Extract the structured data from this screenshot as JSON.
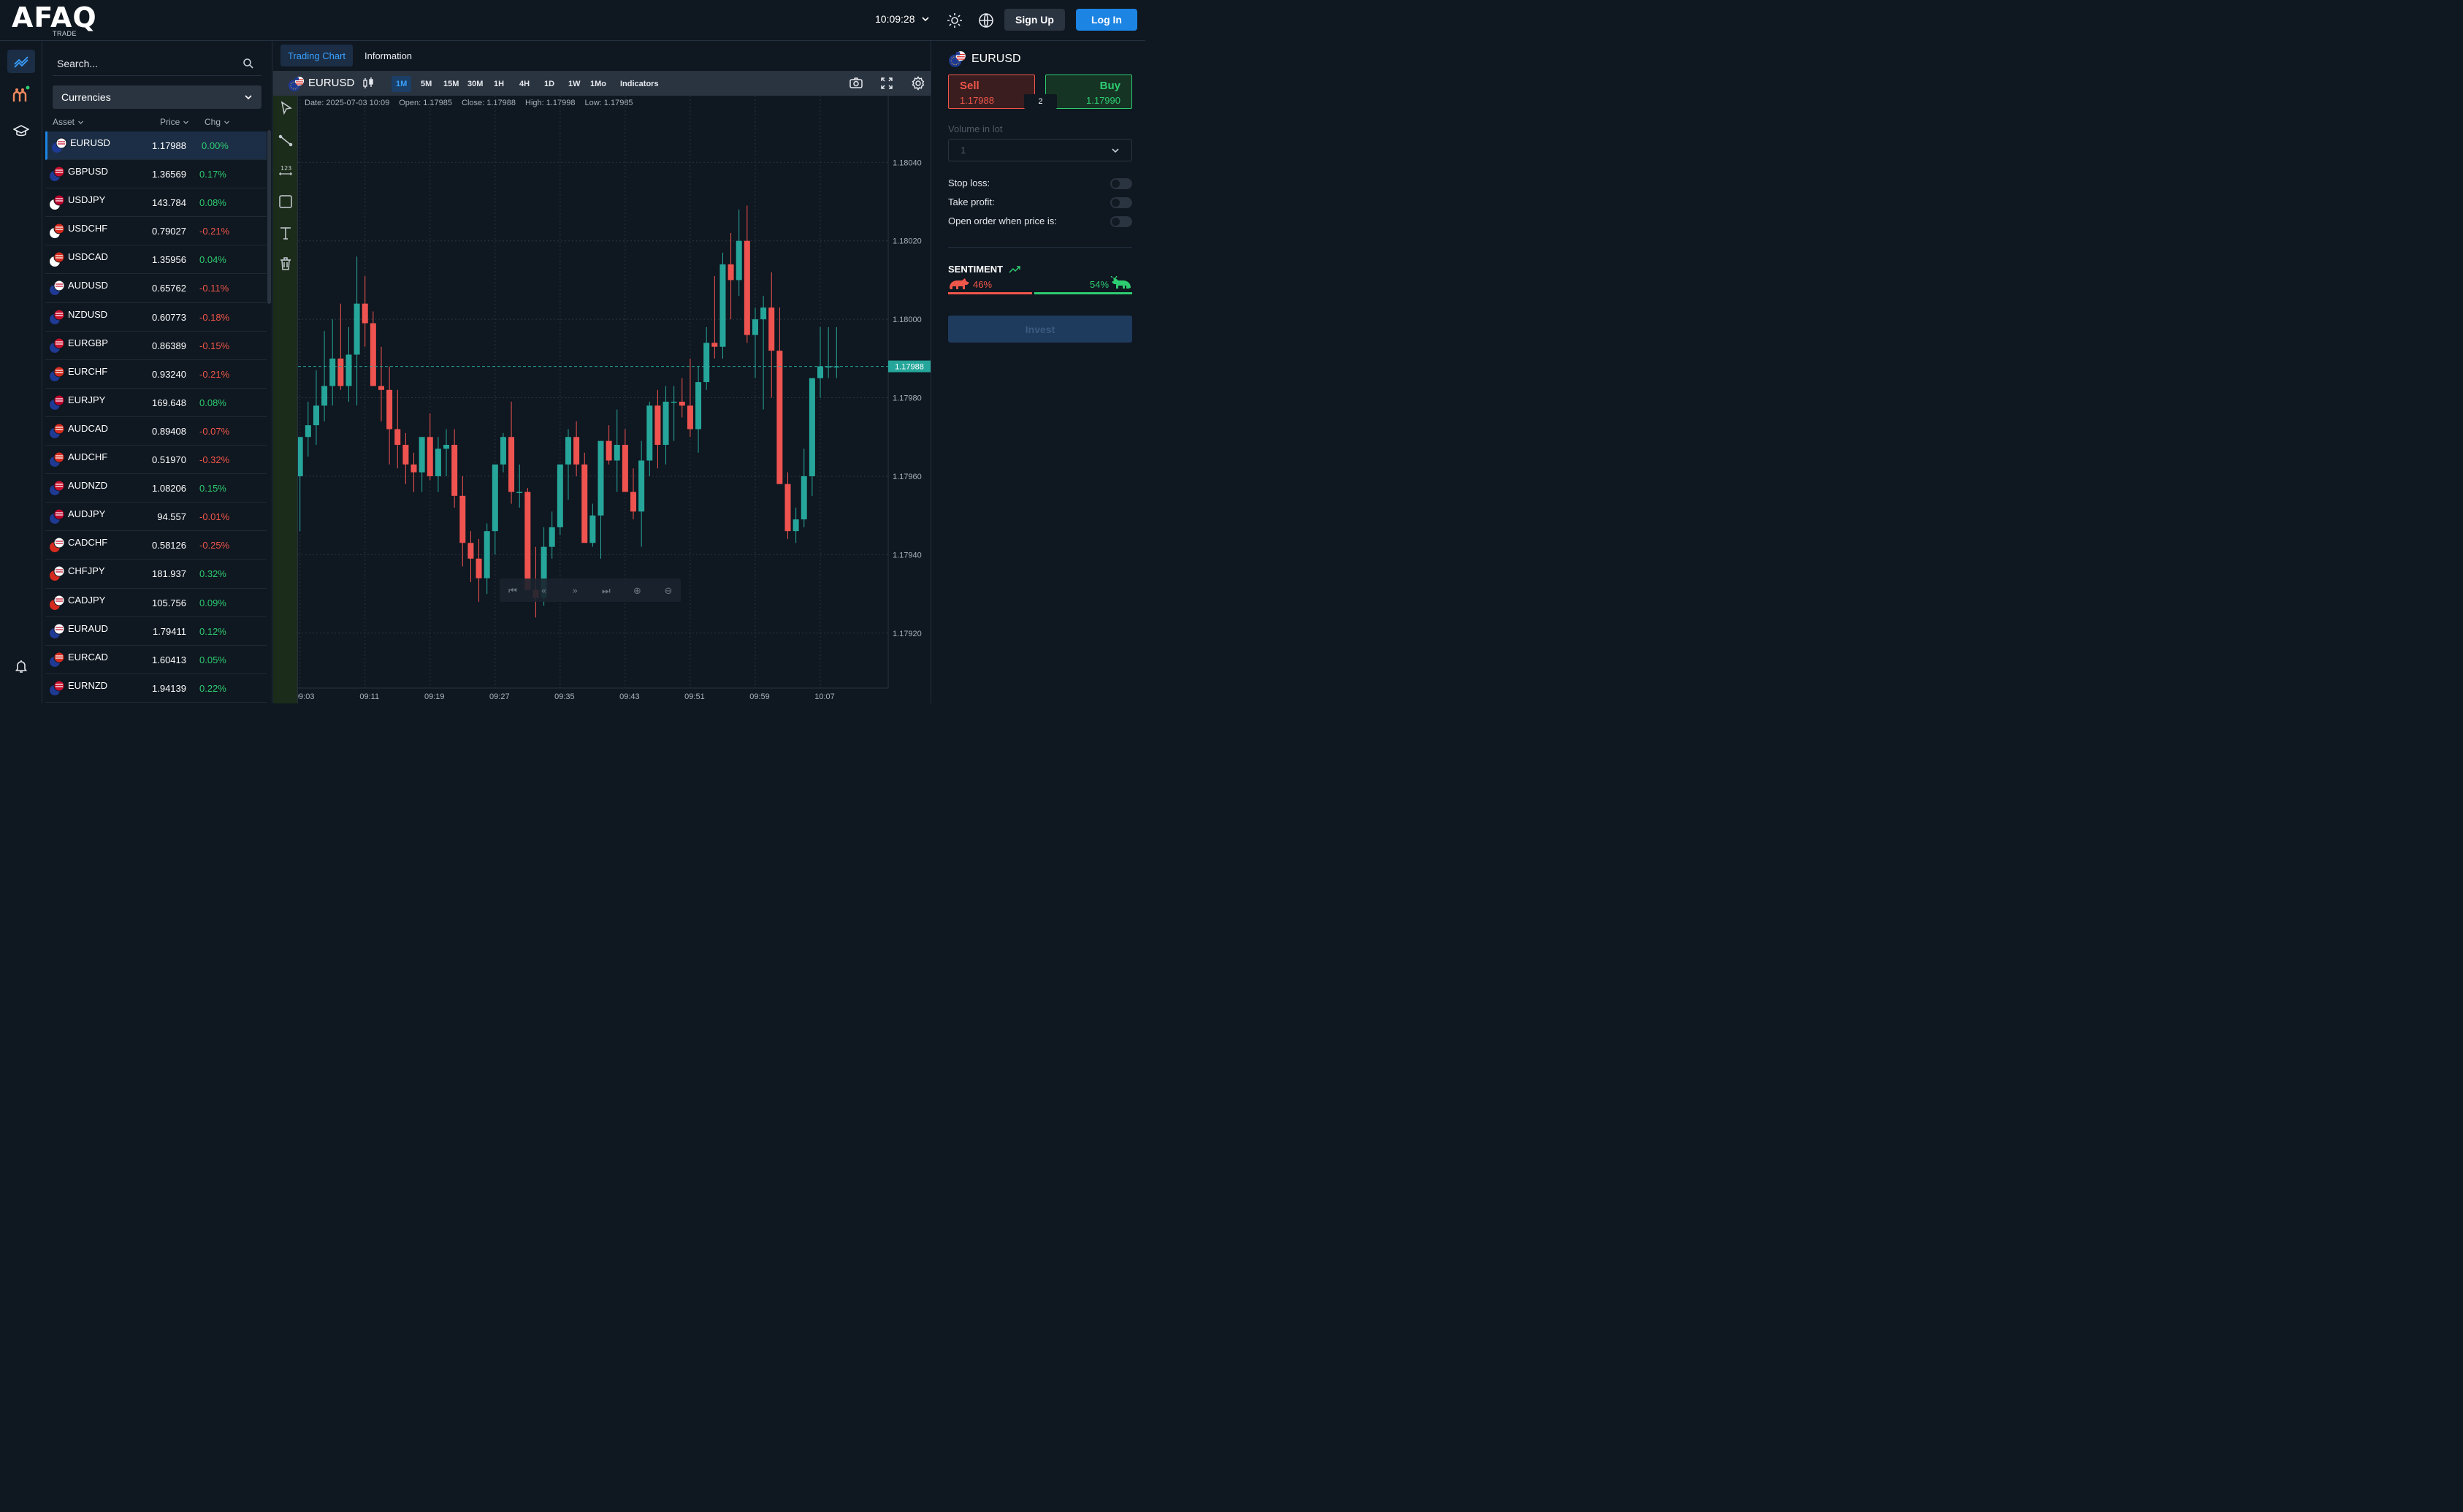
{
  "brand": {
    "name": "AFAQ",
    "sub": "TRADE"
  },
  "header": {
    "time": "10:09:28",
    "signup": "Sign Up",
    "login": "Log In"
  },
  "watchlist": {
    "search_placeholder": "Search...",
    "category": "Currencies",
    "cols": {
      "asset": "Asset",
      "price": "Price",
      "chg": "Chg"
    },
    "rows": [
      {
        "symbol": "EURUSD",
        "price": "1.17988",
        "chg": "0.00%"
      },
      {
        "symbol": "GBPUSD",
        "price": "1.36569",
        "chg": "0.17%"
      },
      {
        "symbol": "USDJPY",
        "price": "143.784",
        "chg": "0.08%"
      },
      {
        "symbol": "USDCHF",
        "price": "0.79027",
        "chg": "-0.21%"
      },
      {
        "symbol": "USDCAD",
        "price": "1.35956",
        "chg": "0.04%"
      },
      {
        "symbol": "AUDUSD",
        "price": "0.65762",
        "chg": "-0.11%"
      },
      {
        "symbol": "NZDUSD",
        "price": "0.60773",
        "chg": "-0.18%"
      },
      {
        "symbol": "EURGBP",
        "price": "0.86389",
        "chg": "-0.15%"
      },
      {
        "symbol": "EURCHF",
        "price": "0.93240",
        "chg": "-0.21%"
      },
      {
        "symbol": "EURJPY",
        "price": "169.648",
        "chg": "0.08%"
      },
      {
        "symbol": "AUDCAD",
        "price": "0.89408",
        "chg": "-0.07%"
      },
      {
        "symbol": "AUDCHF",
        "price": "0.51970",
        "chg": "-0.32%"
      },
      {
        "symbol": "AUDNZD",
        "price": "1.08206",
        "chg": "0.15%"
      },
      {
        "symbol": "AUDJPY",
        "price": "94.557",
        "chg": "-0.01%"
      },
      {
        "symbol": "CADCHF",
        "price": "0.58126",
        "chg": "-0.25%"
      },
      {
        "symbol": "CHFJPY",
        "price": "181.937",
        "chg": "0.32%"
      },
      {
        "symbol": "CADJPY",
        "price": "105.756",
        "chg": "0.09%"
      },
      {
        "symbol": "EURAUD",
        "price": "1.79411",
        "chg": "0.12%"
      },
      {
        "symbol": "EURCAD",
        "price": "1.60413",
        "chg": "0.05%"
      },
      {
        "symbol": "EURNZD",
        "price": "1.94139",
        "chg": "0.22%"
      }
    ]
  },
  "chart": {
    "tabs": [
      "Trading Chart",
      "Information"
    ],
    "symbol": "EURUSD",
    "timeframes": [
      "1M",
      "5M",
      "15M",
      "30M",
      "1H",
      "4H",
      "1D",
      "1W",
      "1Mo"
    ],
    "active_timeframe": "1M",
    "indicators": "Indicators",
    "ohlc": {
      "date": "Date: 2025-07-03 10:09",
      "open": "Open: 1.17985",
      "close": "Close: 1.17988",
      "high": "High: 1.17998",
      "low": "Low: 1.17985"
    },
    "y_ticks": [
      "1.18040",
      "1.18020",
      "1.18000",
      "1.17980",
      "1.17960",
      "1.17940",
      "1.17920"
    ],
    "x_ticks": [
      "09:03",
      "09:11",
      "09:19",
      "09:27",
      "09:35",
      "09:43",
      "09:51",
      "09:59",
      "10:07"
    ],
    "last_price": "1.17988",
    "colors": {
      "up": "#26a69a",
      "down": "#ef5350"
    }
  },
  "trade": {
    "symbol": "EURUSD",
    "sell_label": "Sell",
    "sell_price": "1.17988",
    "buy_label": "Buy",
    "buy_price": "1.17990",
    "spread": "2",
    "volume_label": "Volume in lot",
    "volume_value": "1",
    "stop_loss": "Stop loss:",
    "take_profit": "Take profit:",
    "open_when": "Open order when price is:",
    "sentiment": "SENTIMENT",
    "bear_pct": "46%",
    "bull_pct": "54%",
    "invest": "Invest"
  },
  "chart_data": {
    "type": "candlestick",
    "x": [
      "09:03",
      "09:04",
      "09:05",
      "09:06",
      "09:07",
      "09:08",
      "09:09",
      "09:10",
      "09:11",
      "09:12",
      "09:13",
      "09:14",
      "09:15",
      "09:16",
      "09:17",
      "09:18",
      "09:19",
      "09:20",
      "09:21",
      "09:22",
      "09:23",
      "09:24",
      "09:25",
      "09:26",
      "09:27",
      "09:28",
      "09:29",
      "09:30",
      "09:31",
      "09:32",
      "09:33",
      "09:34",
      "09:35",
      "09:36",
      "09:37",
      "09:38",
      "09:39",
      "09:40",
      "09:41",
      "09:42",
      "09:43",
      "09:44",
      "09:45",
      "09:46",
      "09:47",
      "09:48",
      "09:49",
      "09:50",
      "09:51",
      "09:52",
      "09:53",
      "09:54",
      "09:55",
      "09:56",
      "09:57",
      "09:58",
      "09:59",
      "10:00",
      "10:01",
      "10:02",
      "10:03",
      "10:04",
      "10:05",
      "10:06",
      "10:07",
      "10:08",
      "10:09"
    ],
    "open": [
      1.1796,
      1.1797,
      1.17973,
      1.17978,
      1.17983,
      1.1799,
      1.17983,
      1.17991,
      1.18004,
      1.17999,
      1.17983,
      1.17982,
      1.17972,
      1.17968,
      1.17963,
      1.17961,
      1.1797,
      1.1796,
      1.17967,
      1.17968,
      1.17955,
      1.17943,
      1.17939,
      1.17934,
      1.17946,
      1.17963,
      1.1797,
      1.17956,
      1.17956,
      1.17931,
      1.17929,
      1.17942,
      1.17947,
      1.17963,
      1.1797,
      1.17963,
      1.17943,
      1.1795,
      1.17969,
      1.17964,
      1.17968,
      1.17956,
      1.17951,
      1.17964,
      1.17978,
      1.17968,
      1.17979,
      1.17979,
      1.17978,
      1.17972,
      1.17984,
      1.17994,
      1.17993,
      1.18014,
      1.1801,
      1.1802,
      1.17996,
      1.18,
      1.18003,
      1.17992,
      1.17958,
      1.17946,
      1.17949,
      1.1796,
      1.17985,
      1.17988,
      1.17988
    ],
    "high": [
      1.17963,
      1.17979,
      1.17987,
      1.17997,
      1.18,
      1.18004,
      1.17998,
      1.18016,
      1.18011,
      1.18002,
      1.17993,
      1.17988,
      1.17982,
      1.17971,
      1.17966,
      1.1797,
      1.17976,
      1.1797,
      1.17972,
      1.17972,
      1.1796,
      1.17946,
      1.17944,
      1.17948,
      1.17962,
      1.17971,
      1.17979,
      1.17963,
      1.17957,
      1.17942,
      1.17947,
      1.17951,
      1.17963,
      1.17972,
      1.17974,
      1.17966,
      1.17953,
      1.17966,
      1.17973,
      1.17977,
      1.17972,
      1.17962,
      1.17969,
      1.17979,
      1.17982,
      1.17983,
      1.17983,
      1.17985,
      1.1799,
      1.17988,
      1.17998,
      1.18011,
      1.18017,
      1.18022,
      1.18028,
      1.18029,
      1.18003,
      1.18006,
      1.18012,
      1.18003,
      1.17961,
      1.17952,
      1.17967,
      1.17983,
      1.17998,
      1.17998,
      1.17998
    ],
    "low": [
      1.17946,
      1.17965,
      1.17968,
      1.17974,
      1.17978,
      1.17982,
      1.17979,
      1.17978,
      1.17993,
      1.17983,
      1.17974,
      1.17963,
      1.17962,
      1.17958,
      1.17956,
      1.17956,
      1.17959,
      1.17956,
      1.1796,
      1.17952,
      1.17937,
      1.17933,
      1.17928,
      1.1793,
      1.1794,
      1.17961,
      1.17953,
      1.17952,
      1.17932,
      1.17924,
      1.17927,
      1.17939,
      1.17945,
      1.17954,
      1.1796,
      1.17945,
      1.17942,
      1.17939,
      1.17963,
      1.17956,
      1.1796,
      1.17949,
      1.17942,
      1.1796,
      1.17962,
      1.17963,
      1.17969,
      1.17975,
      1.1797,
      1.17966,
      1.17982,
      1.1799,
      1.1799,
      1.18,
      1.18006,
      1.17994,
      1.17985,
      1.17977,
      1.1798,
      1.17975,
      1.17944,
      1.17943,
      1.17947,
      1.17955,
      1.1798,
      1.17985,
      1.17985
    ],
    "close": [
      1.1797,
      1.17973,
      1.17978,
      1.17983,
      1.1799,
      1.17983,
      1.17991,
      1.18004,
      1.17999,
      1.17983,
      1.17982,
      1.17972,
      1.17968,
      1.17963,
      1.17961,
      1.1797,
      1.1796,
      1.17967,
      1.17968,
      1.17955,
      1.17943,
      1.17939,
      1.17934,
      1.17946,
      1.17963,
      1.1797,
      1.17956,
      1.17956,
      1.17931,
      1.17929,
      1.17942,
      1.17947,
      1.17963,
      1.1797,
      1.17963,
      1.17943,
      1.1795,
      1.17969,
      1.17964,
      1.17968,
      1.17956,
      1.17951,
      1.17964,
      1.17978,
      1.17968,
      1.17979,
      1.17979,
      1.17978,
      1.17972,
      1.17984,
      1.17994,
      1.17993,
      1.18014,
      1.1801,
      1.1802,
      1.17996,
      1.18,
      1.18003,
      1.17992,
      1.17958,
      1.17946,
      1.17949,
      1.1796,
      1.17985,
      1.17988,
      1.17988,
      1.17988
    ],
    "ylim": [
      1.17906,
      1.18057
    ]
  }
}
